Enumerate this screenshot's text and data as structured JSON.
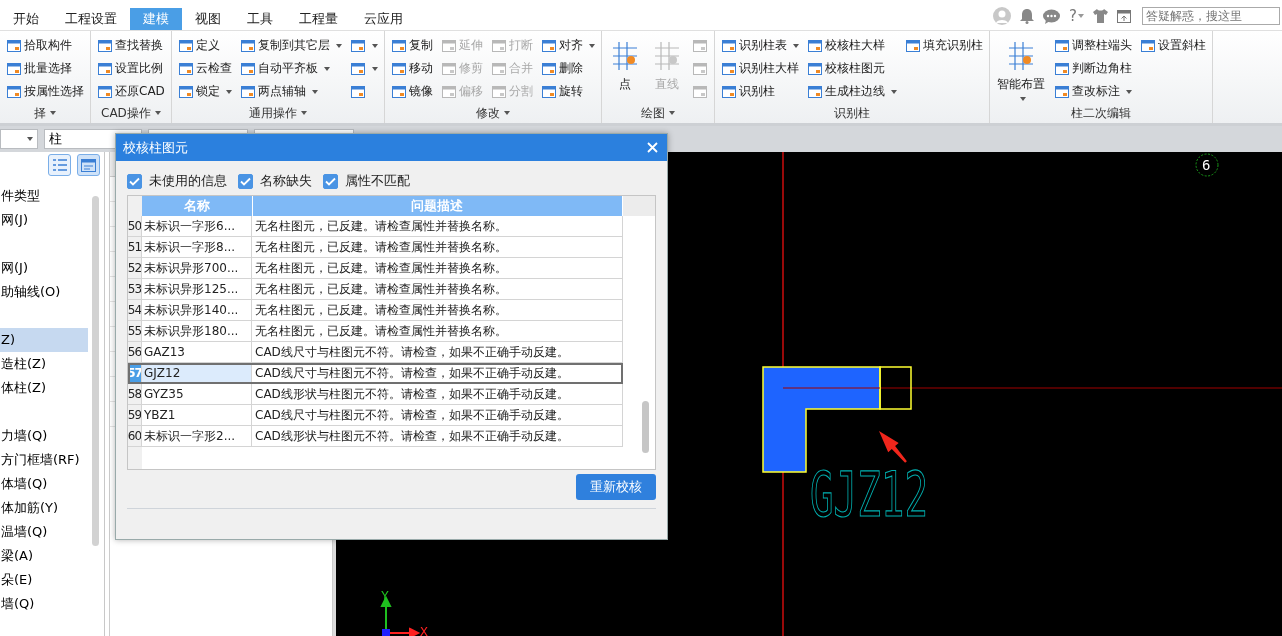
{
  "tabs": [
    {
      "label": "开始",
      "selected": false
    },
    {
      "label": "工程设置",
      "selected": false
    },
    {
      "label": "建模",
      "selected": true
    },
    {
      "label": "视图",
      "selected": false
    },
    {
      "label": "工具",
      "selected": false
    },
    {
      "label": "工程量",
      "selected": false
    },
    {
      "label": "云应用",
      "selected": false
    }
  ],
  "top_right": {
    "help": "?",
    "search": {
      "placeholder": "答疑解惑，搜这里"
    }
  },
  "ribbon": {
    "groups": [
      {
        "title": "择",
        "menu": true,
        "columns": [
          [
            {
              "kind": "small",
              "label": "拾取构件",
              "dropdown": false,
              "disabled": false
            },
            {
              "kind": "small",
              "label": "批量选择",
              "dropdown": false,
              "disabled": false
            },
            {
              "kind": "small",
              "label": "按属性选择",
              "dropdown": false,
              "disabled": false
            }
          ]
        ]
      },
      {
        "title": "CAD操作",
        "menu": true,
        "columns": [
          [
            {
              "kind": "small",
              "label": "查找替换",
              "dropdown": false,
              "disabled": false
            },
            {
              "kind": "small",
              "label": "设置比例",
              "dropdown": false,
              "disabled": false
            },
            {
              "kind": "small",
              "label": "还原CAD",
              "dropdown": false,
              "disabled": false
            }
          ]
        ]
      },
      {
        "title": "通用操作",
        "menu": true,
        "columns": [
          [
            {
              "kind": "small",
              "label": "定义",
              "dropdown": false,
              "disabled": false
            },
            {
              "kind": "small",
              "label": "云检查",
              "dropdown": false,
              "disabled": false
            },
            {
              "kind": "small",
              "label": "锁定",
              "dropdown": true,
              "disabled": false
            }
          ],
          [
            {
              "kind": "small",
              "label": "复制到其它层",
              "dropdown": true,
              "disabled": false
            },
            {
              "kind": "small",
              "label": "自动平齐板",
              "dropdown": true,
              "disabled": false
            },
            {
              "kind": "small",
              "label": "两点辅轴",
              "dropdown": true,
              "disabled": false
            }
          ],
          [
            {
              "kind": "icon",
              "dropdown": true,
              "disabled": false
            },
            {
              "kind": "icon",
              "dropdown": true,
              "disabled": false
            },
            {
              "kind": "icon",
              "dropdown": false,
              "disabled": false
            }
          ]
        ]
      },
      {
        "title": "修改",
        "menu": true,
        "columns": [
          [
            {
              "kind": "small",
              "label": "复制",
              "dropdown": false,
              "disabled": false
            },
            {
              "kind": "small",
              "label": "移动",
              "dropdown": false,
              "disabled": false
            },
            {
              "kind": "small",
              "label": "镜像",
              "dropdown": false,
              "disabled": false
            }
          ],
          [
            {
              "kind": "small",
              "label": "延伸",
              "dropdown": false,
              "disabled": true
            },
            {
              "kind": "small",
              "label": "修剪",
              "dropdown": false,
              "disabled": true
            },
            {
              "kind": "small",
              "label": "偏移",
              "dropdown": false,
              "disabled": true
            }
          ],
          [
            {
              "kind": "small",
              "label": "打断",
              "dropdown": false,
              "disabled": true
            },
            {
              "kind": "small",
              "label": "合并",
              "dropdown": false,
              "disabled": true
            },
            {
              "kind": "small",
              "label": "分割",
              "dropdown": false,
              "disabled": true
            }
          ],
          [
            {
              "kind": "small",
              "label": "对齐",
              "dropdown": true,
              "disabled": false
            },
            {
              "kind": "small",
              "label": "删除",
              "dropdown": false,
              "disabled": false
            },
            {
              "kind": "small",
              "label": "旋转",
              "dropdown": false,
              "disabled": false
            }
          ]
        ]
      },
      {
        "title": "绘图",
        "menu": true,
        "columns": [
          [
            {
              "kind": "large",
              "label": "点",
              "dropdown": false,
              "disabled": false
            }
          ],
          [
            {
              "kind": "large",
              "label": "直线",
              "dropdown": false,
              "disabled": true
            }
          ],
          [
            {
              "kind": "icon",
              "dropdown": false,
              "disabled": true
            },
            {
              "kind": "icon",
              "dropdown": false,
              "disabled": true
            },
            {
              "kind": "icon",
              "dropdown": false,
              "disabled": true
            }
          ]
        ]
      },
      {
        "title": "识别柱",
        "menu": false,
        "columns": [
          [
            {
              "kind": "small",
              "label": "识别柱表",
              "dropdown": true,
              "disabled": false
            },
            {
              "kind": "small",
              "label": "识别柱大样",
              "dropdown": false,
              "disabled": false
            },
            {
              "kind": "small",
              "label": "识别柱",
              "dropdown": false,
              "disabled": false
            }
          ],
          [
            {
              "kind": "small",
              "label": "校核柱大样",
              "dropdown": false,
              "disabled": false
            },
            {
              "kind": "small",
              "label": "校核柱图元",
              "dropdown": false,
              "disabled": false
            },
            {
              "kind": "small",
              "label": "生成柱边线",
              "dropdown": true,
              "disabled": false
            }
          ],
          [
            {
              "kind": "small",
              "label": "填充识别柱",
              "dropdown": false,
              "disabled": false
            }
          ]
        ]
      },
      {
        "title": "柱二次编辑",
        "menu": false,
        "columns": [
          [
            {
              "kind": "large",
              "label": "智能布置",
              "dropdown": true,
              "disabled": false
            }
          ],
          [
            {
              "kind": "small",
              "label": "调整柱端头",
              "dropdown": false,
              "disabled": false
            },
            {
              "kind": "small",
              "label": "判断边角柱",
              "dropdown": false,
              "disabled": false
            },
            {
              "kind": "small",
              "label": "查改标注",
              "dropdown": true,
              "disabled": false
            }
          ],
          [
            {
              "kind": "small",
              "label": "设置斜柱",
              "dropdown": false,
              "disabled": false
            }
          ]
        ]
      }
    ]
  },
  "filter_bar": {
    "category": "柱"
  },
  "tree": {
    "groups": [
      {
        "items": [
          {
            "label": "件类型",
            "selected": false
          },
          {
            "label": "网(J)",
            "selected": false
          }
        ]
      },
      {
        "items": [
          {
            "label": "网(J)",
            "selected": false
          },
          {
            "label": "助轴线(O)",
            "selected": false
          }
        ]
      },
      {
        "items": [
          {
            "label": "Z)",
            "selected": true
          },
          {
            "label": "造柱(Z)",
            "selected": false
          },
          {
            "label": "体柱(Z)",
            "selected": false
          }
        ]
      },
      {
        "items": [
          {
            "label": "力墙(Q)",
            "selected": false
          },
          {
            "label": "方门框墙(RF)",
            "selected": false
          },
          {
            "label": "体墙(Q)",
            "selected": false
          },
          {
            "label": "体加筋(Y)",
            "selected": false
          },
          {
            "label": "温墙(Q)",
            "selected": false
          },
          {
            "label": "梁(A)",
            "selected": false
          },
          {
            "label": "朵(E)",
            "selected": false
          },
          {
            "label": "墙(Q)",
            "selected": false
          }
        ]
      }
    ]
  },
  "canvas": {
    "column_label": "GJZ12",
    "axis_number": "6",
    "axes": {
      "x": "X",
      "y": "Y"
    }
  },
  "dialog": {
    "title": "校核柱图元",
    "filters": [
      {
        "label": "未使用的信息",
        "checked": true
      },
      {
        "label": "名称缺失",
        "checked": true
      },
      {
        "label": "属性不匹配",
        "checked": true
      }
    ],
    "table": {
      "columns": [
        "名称",
        "问题描述"
      ],
      "rows": [
        {
          "index": "50",
          "name": "未标识一字形6...",
          "description": "无名柱图元，已反建。请检查属性并替换名称。",
          "selected": false
        },
        {
          "index": "51",
          "name": "未标识一字形8...",
          "description": "无名柱图元，已反建。请检查属性并替换名称。",
          "selected": false
        },
        {
          "index": "52",
          "name": "未标识异形700...",
          "description": "无名柱图元，已反建。请检查属性并替换名称。",
          "selected": false
        },
        {
          "index": "53",
          "name": "未标识异形125...",
          "description": "无名柱图元，已反建。请检查属性并替换名称。",
          "selected": false
        },
        {
          "index": "54",
          "name": "未标识异形140...",
          "description": "无名柱图元，已反建。请检查属性并替换名称。",
          "selected": false
        },
        {
          "index": "55",
          "name": "未标识异形180...",
          "description": "无名柱图元，已反建。请检查属性并替换名称。",
          "selected": false
        },
        {
          "index": "56",
          "name": "GAZ13",
          "description": "CAD线尺寸与柱图元不符。请检查，如果不正确手动反建。",
          "selected": false
        },
        {
          "index": "57",
          "name": "GJZ12",
          "description": "CAD线尺寸与柱图元不符。请检查，如果不正确手动反建。",
          "selected": true
        },
        {
          "index": "58",
          "name": "GYZ35",
          "description": "CAD线形状与柱图元不符。请检查，如果不正确手动反建。",
          "selected": false
        },
        {
          "index": "59",
          "name": "YBZ1",
          "description": "CAD线尺寸与柱图元不符。请检查，如果不正确手动反建。",
          "selected": false
        },
        {
          "index": "60",
          "name": "未标识一字形2...",
          "description": "CAD线形状与柱图元不符。请检查，如果不正确手动反建。",
          "selected": false
        }
      ]
    },
    "button": "重新校核"
  }
}
